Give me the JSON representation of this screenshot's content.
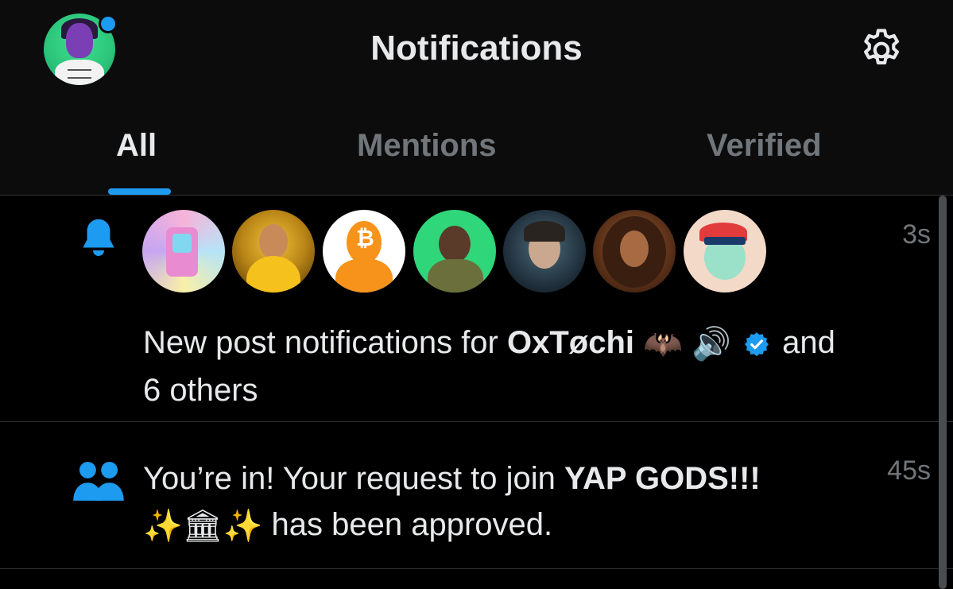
{
  "header": {
    "title": "Notifications",
    "avatar_icon": "profile-avatar",
    "settings_icon": "gear-icon"
  },
  "tabs": [
    {
      "label": "All",
      "active": true
    },
    {
      "label": "Mentions",
      "active": false
    },
    {
      "label": "Verified",
      "active": false
    }
  ],
  "colors": {
    "accent": "#1d9bf0",
    "text_primary": "#e7e9ea",
    "text_secondary": "#71767b",
    "background": "#000000"
  },
  "notifications": [
    {
      "type": "new-post",
      "icon": "bell-icon",
      "time": "3s",
      "text_prefix": "New post notifications for ",
      "name": "OxTøchi",
      "name_emojis": "🦇 🔊",
      "verified": true,
      "text_suffix": " and",
      "text_line2": "6 others",
      "avatar_count": 7
    },
    {
      "type": "community",
      "icon": "people-icon",
      "time": "45s",
      "text_prefix": "You’re in! Your request to join ",
      "community": "YAP GODS!!!",
      "community_emojis": "✨🏛✨",
      "text_suffix": " has been approved."
    }
  ]
}
